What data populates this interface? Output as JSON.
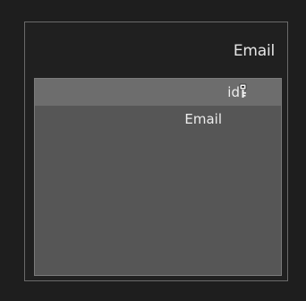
{
  "panel": {
    "title": "Email",
    "rows": [
      {
        "label": "id",
        "icon": "primary-key-icon",
        "selected": true
      },
      {
        "label": "Email",
        "selected": false
      }
    ]
  }
}
